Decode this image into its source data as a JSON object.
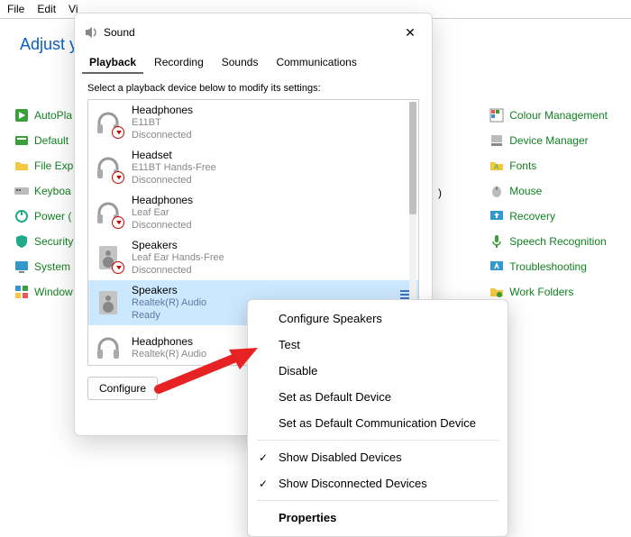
{
  "menubar": {
    "items": [
      "File",
      "Edit",
      "Vi"
    ]
  },
  "control_panel": {
    "header": "Adjust y",
    "left_items": [
      "AutoPla",
      "Default",
      "File Exp",
      "Keyboa",
      "Power (",
      "Security",
      "System",
      "Window"
    ],
    "right_items": [
      "Colour Management",
      "Device Manager",
      "Fonts",
      "Mouse",
      "Recovery",
      "Speech Recognition",
      "Troubleshooting",
      "Work Folders"
    ],
    "stray_paren": ")"
  },
  "sound_dialog": {
    "title": "Sound",
    "tabs": [
      "Playback",
      "Recording",
      "Sounds",
      "Communications"
    ],
    "active_tab": 0,
    "subtext": "Select a playback device below to modify its settings:",
    "devices": [
      {
        "name": "Headphones",
        "sub": "E11BT",
        "state": "Disconnected",
        "kind": "hp",
        "badge": "disc"
      },
      {
        "name": "Headset",
        "sub": "E11BT Hands-Free",
        "state": "Disconnected",
        "kind": "hp",
        "badge": "disc"
      },
      {
        "name": "Headphones",
        "sub": "Leaf Ear",
        "state": "Disconnected",
        "kind": "hp",
        "badge": "disc"
      },
      {
        "name": "Speakers",
        "sub": "Leaf Ear Hands-Free",
        "state": "Disconnected",
        "kind": "spk",
        "badge": "disc"
      },
      {
        "name": "Speakers",
        "sub": "Realtek(R) Audio",
        "state": "Ready",
        "kind": "spk",
        "badge": "",
        "selected": true,
        "eq": true
      },
      {
        "name": "Headphones",
        "sub": "Realtek(R) Audio",
        "state": "",
        "kind": "hp",
        "badge": ""
      }
    ],
    "configure_btn": "Configure",
    "ok_btn": ""
  },
  "context_menu": {
    "items": [
      {
        "label": "Configure Speakers",
        "checked": false
      },
      {
        "label": "Test",
        "checked": false
      },
      {
        "label": "Disable",
        "checked": false
      },
      {
        "label": "Set as Default Device",
        "checked": false
      },
      {
        "label": "Set as Default Communication Device",
        "checked": false
      }
    ],
    "sep": true,
    "items2": [
      {
        "label": "Show Disabled Devices",
        "checked": true
      },
      {
        "label": "Show Disconnected Devices",
        "checked": true
      }
    ],
    "sep2": true,
    "properties": "Properties"
  }
}
